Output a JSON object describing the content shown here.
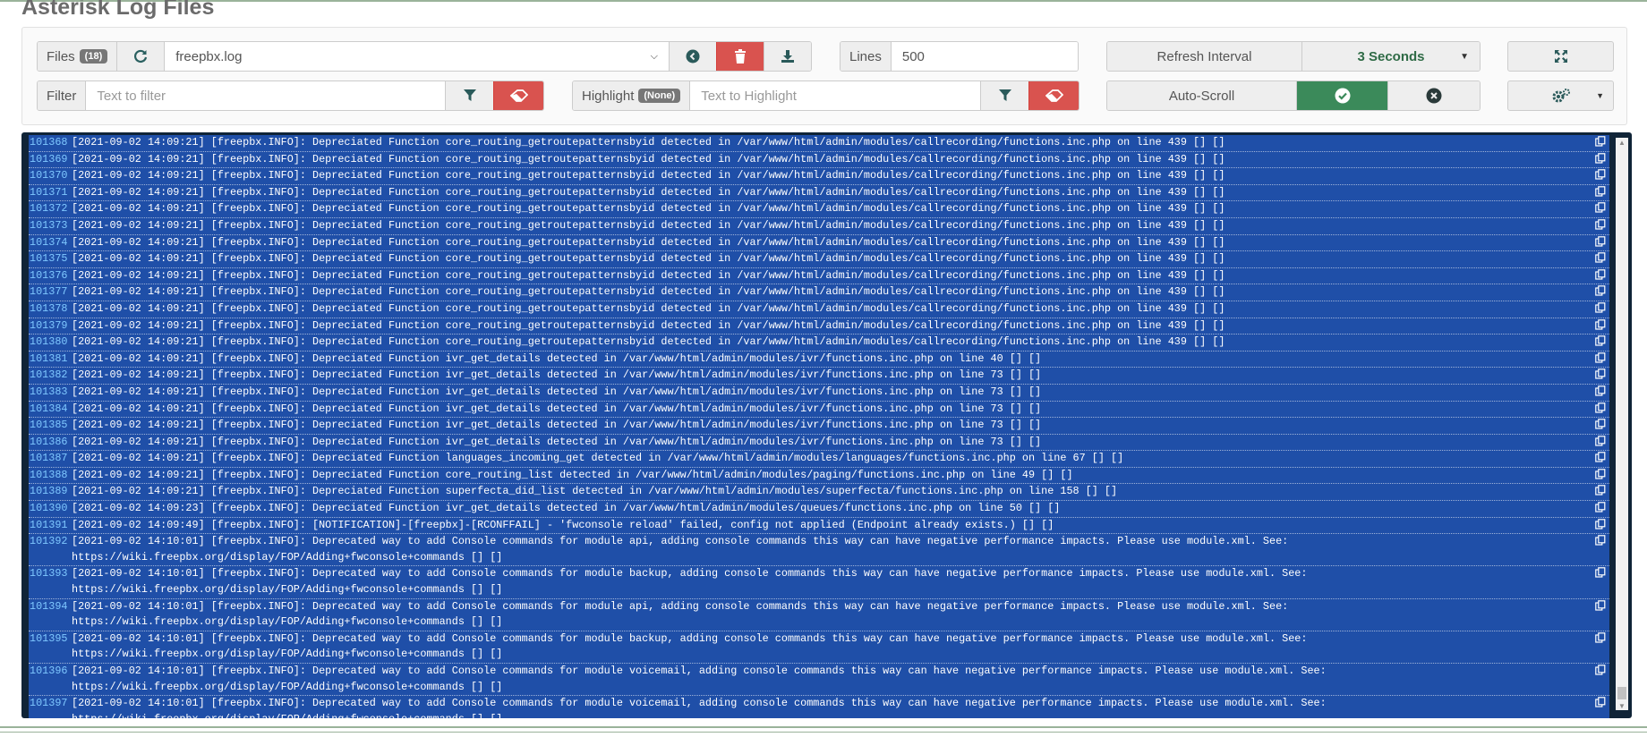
{
  "page": {
    "title": "Asterisk Log Files"
  },
  "toolbar": {
    "files_label": "Files",
    "files_count": "(18)",
    "file_selected": "freepbx.log",
    "lines_label": "Lines",
    "lines_value": "500",
    "refresh_label": "Refresh Interval",
    "refresh_value": "3 Seconds",
    "filter_label": "Filter",
    "filter_placeholder": "Text to filter",
    "highlight_label": "Highlight",
    "highlight_badge": "(None)",
    "highlight_placeholder": "Text to Highlight",
    "autoscroll_label": "Auto-Scroll"
  },
  "colors": {
    "accent_green": "#3b8a5a",
    "danger_red": "#d9534f",
    "log_bg": "#1f4fa8",
    "line_number": "#7fc8ff"
  },
  "log": {
    "rows": [
      {
        "n": "101368",
        "t": "[2021-09-02 14:09:21] [freepbx.INFO]: Depreciated Function core_routing_getroutepatternsbyid detected in /var/www/html/admin/modules/callrecording/functions.inc.php on line 439 [] []"
      },
      {
        "n": "101369",
        "t": "[2021-09-02 14:09:21] [freepbx.INFO]: Depreciated Function core_routing_getroutepatternsbyid detected in /var/www/html/admin/modules/callrecording/functions.inc.php on line 439 [] []"
      },
      {
        "n": "101370",
        "t": "[2021-09-02 14:09:21] [freepbx.INFO]: Depreciated Function core_routing_getroutepatternsbyid detected in /var/www/html/admin/modules/callrecording/functions.inc.php on line 439 [] []"
      },
      {
        "n": "101371",
        "t": "[2021-09-02 14:09:21] [freepbx.INFO]: Depreciated Function core_routing_getroutepatternsbyid detected in /var/www/html/admin/modules/callrecording/functions.inc.php on line 439 [] []"
      },
      {
        "n": "101372",
        "t": "[2021-09-02 14:09:21] [freepbx.INFO]: Depreciated Function core_routing_getroutepatternsbyid detected in /var/www/html/admin/modules/callrecording/functions.inc.php on line 439 [] []"
      },
      {
        "n": "101373",
        "t": "[2021-09-02 14:09:21] [freepbx.INFO]: Depreciated Function core_routing_getroutepatternsbyid detected in /var/www/html/admin/modules/callrecording/functions.inc.php on line 439 [] []"
      },
      {
        "n": "101374",
        "t": "[2021-09-02 14:09:21] [freepbx.INFO]: Depreciated Function core_routing_getroutepatternsbyid detected in /var/www/html/admin/modules/callrecording/functions.inc.php on line 439 [] []"
      },
      {
        "n": "101375",
        "t": "[2021-09-02 14:09:21] [freepbx.INFO]: Depreciated Function core_routing_getroutepatternsbyid detected in /var/www/html/admin/modules/callrecording/functions.inc.php on line 439 [] []"
      },
      {
        "n": "101376",
        "t": "[2021-09-02 14:09:21] [freepbx.INFO]: Depreciated Function core_routing_getroutepatternsbyid detected in /var/www/html/admin/modules/callrecording/functions.inc.php on line 439 [] []"
      },
      {
        "n": "101377",
        "t": "[2021-09-02 14:09:21] [freepbx.INFO]: Depreciated Function core_routing_getroutepatternsbyid detected in /var/www/html/admin/modules/callrecording/functions.inc.php on line 439 [] []"
      },
      {
        "n": "101378",
        "t": "[2021-09-02 14:09:21] [freepbx.INFO]: Depreciated Function core_routing_getroutepatternsbyid detected in /var/www/html/admin/modules/callrecording/functions.inc.php on line 439 [] []"
      },
      {
        "n": "101379",
        "t": "[2021-09-02 14:09:21] [freepbx.INFO]: Depreciated Function core_routing_getroutepatternsbyid detected in /var/www/html/admin/modules/callrecording/functions.inc.php on line 439 [] []"
      },
      {
        "n": "101380",
        "t": "[2021-09-02 14:09:21] [freepbx.INFO]: Depreciated Function core_routing_getroutepatternsbyid detected in /var/www/html/admin/modules/callrecording/functions.inc.php on line 439 [] []"
      },
      {
        "n": "101381",
        "t": "[2021-09-02 14:09:21] [freepbx.INFO]: Depreciated Function ivr_get_details detected in /var/www/html/admin/modules/ivr/functions.inc.php on line 40 [] []"
      },
      {
        "n": "101382",
        "t": "[2021-09-02 14:09:21] [freepbx.INFO]: Depreciated Function ivr_get_details detected in /var/www/html/admin/modules/ivr/functions.inc.php on line 73 [] []"
      },
      {
        "n": "101383",
        "t": "[2021-09-02 14:09:21] [freepbx.INFO]: Depreciated Function ivr_get_details detected in /var/www/html/admin/modules/ivr/functions.inc.php on line 73 [] []"
      },
      {
        "n": "101384",
        "t": "[2021-09-02 14:09:21] [freepbx.INFO]: Depreciated Function ivr_get_details detected in /var/www/html/admin/modules/ivr/functions.inc.php on line 73 [] []"
      },
      {
        "n": "101385",
        "t": "[2021-09-02 14:09:21] [freepbx.INFO]: Depreciated Function ivr_get_details detected in /var/www/html/admin/modules/ivr/functions.inc.php on line 73 [] []"
      },
      {
        "n": "101386",
        "t": "[2021-09-02 14:09:21] [freepbx.INFO]: Depreciated Function ivr_get_details detected in /var/www/html/admin/modules/ivr/functions.inc.php on line 73 [] []"
      },
      {
        "n": "101387",
        "t": "[2021-09-02 14:09:21] [freepbx.INFO]: Depreciated Function languages_incoming_get detected in /var/www/html/admin/modules/languages/functions.inc.php on line 67 [] []"
      },
      {
        "n": "101388",
        "t": "[2021-09-02 14:09:21] [freepbx.INFO]: Depreciated Function core_routing_list detected in /var/www/html/admin/modules/paging/functions.inc.php on line 49 [] []"
      },
      {
        "n": "101389",
        "t": "[2021-09-02 14:09:21] [freepbx.INFO]: Depreciated Function superfecta_did_list detected in /var/www/html/admin/modules/superfecta/functions.inc.php on line 158 [] []"
      },
      {
        "n": "101390",
        "t": "[2021-09-02 14:09:23] [freepbx.INFO]: Depreciated Function ivr_get_details detected in /var/www/html/admin/modules/queues/functions.inc.php on line 50 [] []"
      },
      {
        "n": "101391",
        "t": "[2021-09-02 14:09:49] [freepbx.INFO]: [NOTIFICATION]-[freepbx]-[RCONFFAIL] - 'fwconsole reload' failed, config not applied (Endpoint already exists.) [] []"
      },
      {
        "n": "101392",
        "t": "[2021-09-02 14:10:01] [freepbx.INFO]: Deprecated way to add Console commands for module api, adding console commands this way can have negative performance impacts. Please use module.xml. See:\nhttps://wiki.freepbx.org/display/FOP/Adding+fwconsole+commands [] []"
      },
      {
        "n": "101393",
        "t": "[2021-09-02 14:10:01] [freepbx.INFO]: Deprecated way to add Console commands for module backup, adding console commands this way can have negative performance impacts. Please use module.xml. See:\nhttps://wiki.freepbx.org/display/FOP/Adding+fwconsole+commands [] []"
      },
      {
        "n": "101394",
        "t": "[2021-09-02 14:10:01] [freepbx.INFO]: Deprecated way to add Console commands for module api, adding console commands this way can have negative performance impacts. Please use module.xml. See:\nhttps://wiki.freepbx.org/display/FOP/Adding+fwconsole+commands [] []"
      },
      {
        "n": "101395",
        "t": "[2021-09-02 14:10:01] [freepbx.INFO]: Deprecated way to add Console commands for module backup, adding console commands this way can have negative performance impacts. Please use module.xml. See:\nhttps://wiki.freepbx.org/display/FOP/Adding+fwconsole+commands [] []"
      },
      {
        "n": "101396",
        "t": "[2021-09-02 14:10:01] [freepbx.INFO]: Deprecated way to add Console commands for module voicemail, adding console commands this way can have negative performance impacts. Please use module.xml. See:\nhttps://wiki.freepbx.org/display/FOP/Adding+fwconsole+commands [] []"
      },
      {
        "n": "101397",
        "t": "[2021-09-02 14:10:01] [freepbx.INFO]: Deprecated way to add Console commands for module voicemail, adding console commands this way can have negative performance impacts. Please use module.xml. See:\nhttps://wiki.freepbx.org/display/FOP/Adding+fwconsole+commands [] []"
      }
    ]
  }
}
